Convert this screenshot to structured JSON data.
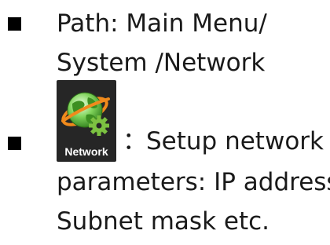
{
  "items": [
    {
      "lines": [
        "Path: Main Menu/",
        "System /Network"
      ]
    },
    {
      "icon": {
        "name": "network-globe-gear-icon",
        "label": "Network"
      },
      "separator": "：",
      "lines": [
        "Setup network",
        "parameters: IP address,",
        "Subnet mask etc."
      ]
    }
  ],
  "colors": {
    "text": "#1a1a1a",
    "bullet": "#000000",
    "icon_tile": "#262626",
    "globe_green": "#4caf2e",
    "swoosh_orange": "#f08a1c",
    "gear_green": "#7cc242"
  }
}
